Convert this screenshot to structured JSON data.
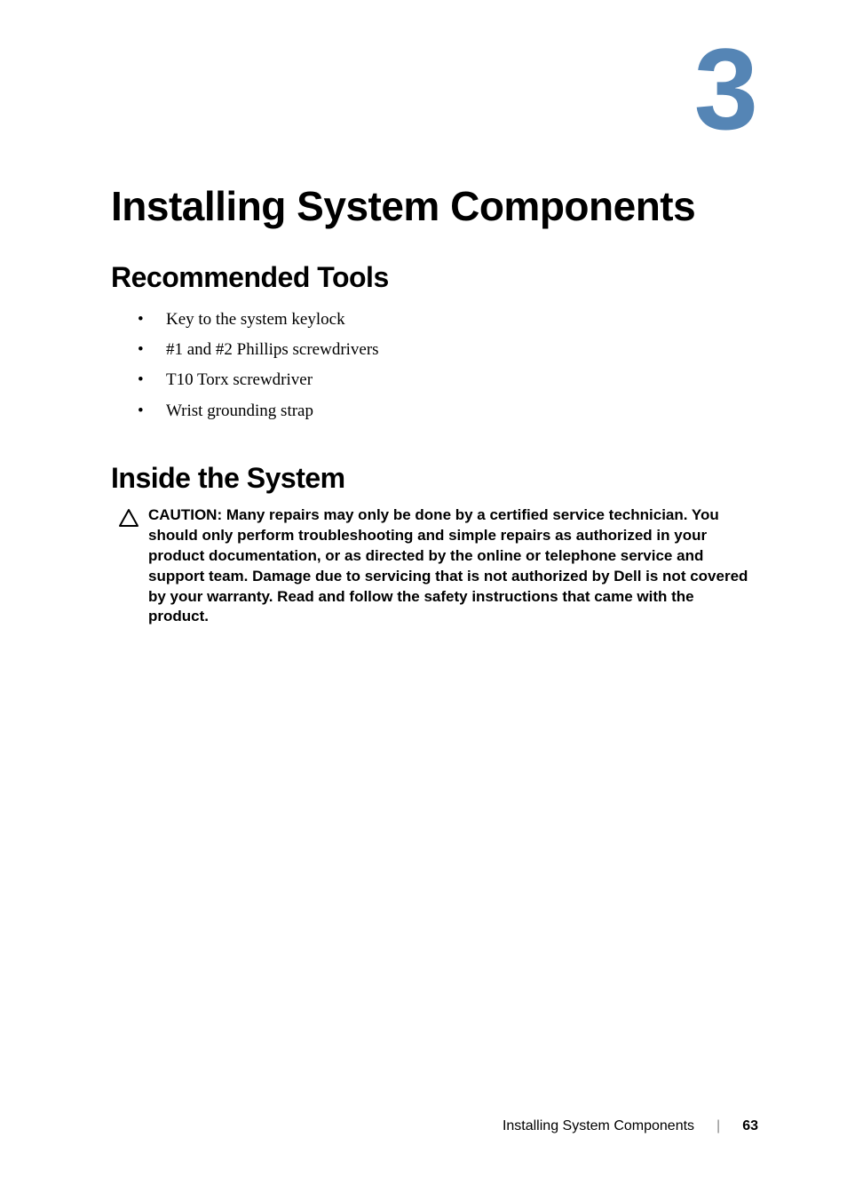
{
  "chapter": {
    "number": "3",
    "title": "Installing System Components"
  },
  "sections": {
    "tools": {
      "heading": "Recommended Tools",
      "items": [
        "Key to the system keylock",
        "#1 and #2 Phillips screwdrivers",
        "T10 Torx screwdriver",
        "Wrist grounding strap"
      ]
    },
    "inside": {
      "heading": "Inside the System",
      "caution_label": "CAUTION: ",
      "caution_text": "Many repairs may only be done by a certified service technician. You should only perform troubleshooting and simple repairs as authorized in your product documentation, or as directed by the online or telephone service and support team. Damage due to servicing that is not authorized by Dell is not covered by your warranty. Read and follow the safety instructions that came with the product."
    }
  },
  "footer": {
    "title": "Installing System Components",
    "page": "63"
  }
}
